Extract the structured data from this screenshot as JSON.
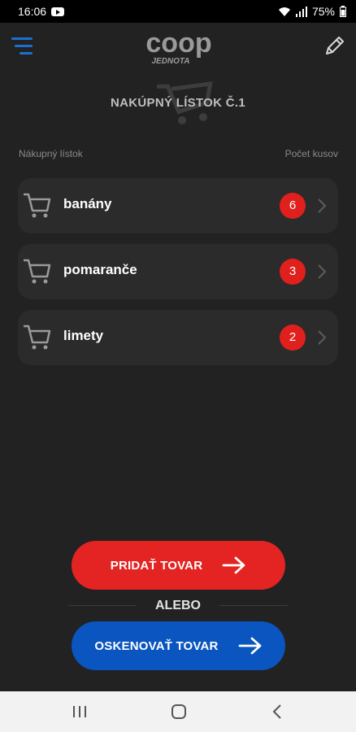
{
  "status_bar": {
    "time": "16:06",
    "battery": "75%"
  },
  "header": {
    "logo_text": "coop",
    "logo_subtext": "JEDNOTA"
  },
  "list": {
    "title": "NAKÚPNÝ LÍSTOK Č.1",
    "col_left": "Nákupný lístok",
    "col_right": "Počet kusov",
    "items": [
      {
        "name": "banány",
        "count": "6"
      },
      {
        "name": "pomaranče",
        "count": "3"
      },
      {
        "name": "limety",
        "count": "2"
      }
    ]
  },
  "actions": {
    "add_label": "PRIDAŤ TOVAR",
    "or_label": "ALEBO",
    "scan_label": "OSKENOVAŤ TOVAR"
  },
  "colors": {
    "accent_red": "#e32422",
    "accent_blue": "#0a55bf",
    "background": "#222222",
    "menu_blue": "#1d6fd1"
  },
  "icons": [
    "menu-icon",
    "pencil-icon",
    "cart-icon",
    "chevron-right-icon",
    "arrow-right-icon",
    "recents-icon",
    "home-icon",
    "back-icon",
    "wifi-icon",
    "signal-icon",
    "battery-icon",
    "youtube-icon"
  ]
}
